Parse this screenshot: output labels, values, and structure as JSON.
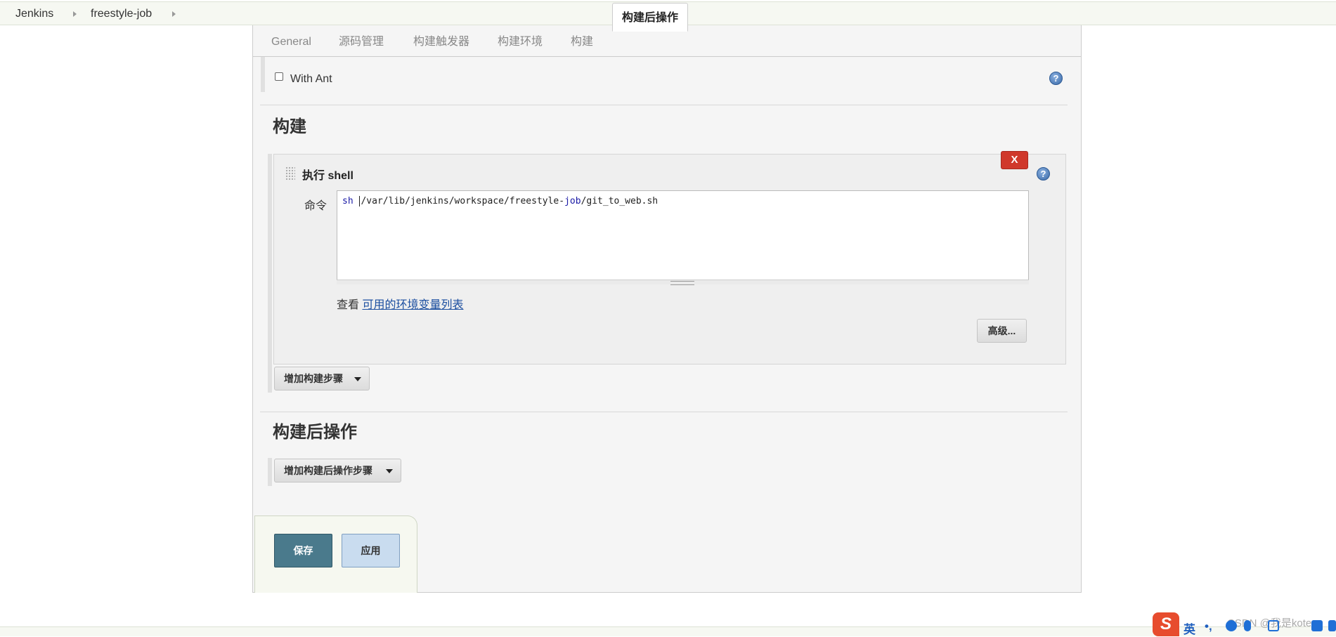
{
  "breadcrumb": {
    "items": [
      "Jenkins",
      "freestyle-job"
    ]
  },
  "tabs": [
    {
      "label": "General"
    },
    {
      "label": "源码管理"
    },
    {
      "label": "构建触发器"
    },
    {
      "label": "构建环境"
    },
    {
      "label": "构建"
    },
    {
      "label": "构建后操作",
      "active": true
    }
  ],
  "build_env": {
    "with_ant_label": "With Ant",
    "with_ant_checked": false
  },
  "build": {
    "section_title": "构建",
    "step": {
      "title": "执行 shell",
      "delete_label": "X",
      "command_label": "命令",
      "command_prefix": "sh",
      "command_path_a": "/var/lib/jenkins/workspace/freestyle-",
      "command_path_kw": "job",
      "command_path_b": "/git_to_web.sh",
      "env_prefix": "查看",
      "env_link": "可用的环境变量列表",
      "advanced_label": "高级..."
    },
    "add_step_label": "增加构建步骤"
  },
  "post_build": {
    "section_title": "构建后操作",
    "add_step_label": "增加构建后操作步骤"
  },
  "actions": {
    "save_label": "保存",
    "apply_label": "应用"
  },
  "help_icon_glyph": "?",
  "ime": {
    "logo": "S",
    "lang": "英",
    "punct": "•,"
  },
  "watermark": "CSDN @我是koten",
  "colors": {
    "delete_button": "#d0382b",
    "save_button": "#4a7a8c",
    "apply_button": "#c9dcef",
    "link": "#1c4fa0"
  }
}
